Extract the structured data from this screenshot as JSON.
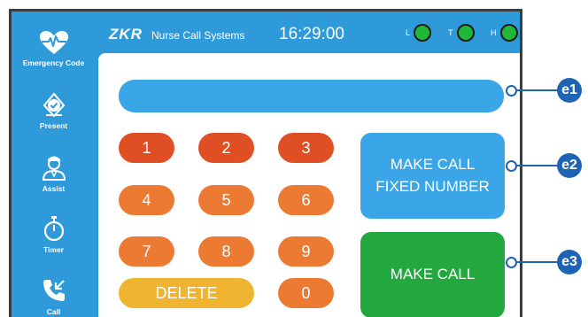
{
  "sidebar": {
    "items": [
      {
        "label": "Emergency Code",
        "icon": "heart-pulse-icon"
      },
      {
        "label": "Present",
        "icon": "badge-check-icon"
      },
      {
        "label": "Assist",
        "icon": "nurse-icon"
      },
      {
        "label": "Timer",
        "icon": "stopwatch-icon"
      },
      {
        "label": "Call",
        "icon": "phone-call-icon"
      }
    ]
  },
  "header": {
    "brand": "ZKR",
    "subtitle": "Nurse Call Systems",
    "time": "16:29:00",
    "indicators": [
      {
        "label": "L",
        "color": "#20b838"
      },
      {
        "label": "T",
        "color": "#20b838"
      },
      {
        "label": "H",
        "color": "#20b838"
      }
    ]
  },
  "display": {
    "value": ""
  },
  "keypad": {
    "keys": [
      "1",
      "2",
      "3",
      "4",
      "5",
      "6",
      "7",
      "8",
      "9",
      "0"
    ],
    "delete_label": "DELETE"
  },
  "actions": {
    "fixed_line1": "MAKE CALL",
    "fixed_line2": "FIXED NUMBER",
    "call_label": "MAKE CALL"
  },
  "callouts": [
    "e1",
    "e2",
    "e3"
  ],
  "colors": {
    "primary": "#2f9ad9",
    "display": "#3aa6e8",
    "key_red": "#e04e24",
    "key_orange": "#ec7a33",
    "key_yellow": "#efb430",
    "call_green": "#22a83e",
    "callout": "#1f64b4"
  }
}
